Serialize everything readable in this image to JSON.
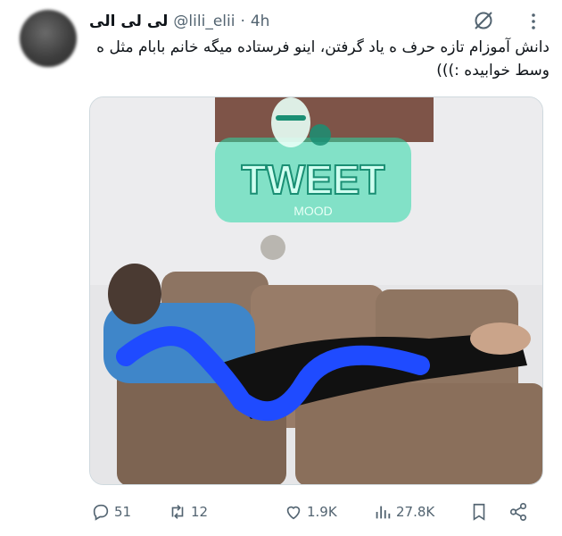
{
  "tweet": {
    "display_name": "لی لی الی",
    "handle": "@lili_elii",
    "separator": "·",
    "time": "4h",
    "text": "دانش آموزام تازه حرف ه یاد گرفتن، اینو فرستاده میگه خانم بابام مثل ه وسط خوابیده :)))"
  },
  "media": {
    "watermark_text": "TWEET",
    "watermark_subtext": "MOOD",
    "watermark_color": "#2bd9a8"
  },
  "actions": {
    "replies": "51",
    "retweets": "12",
    "likes": "1.9K",
    "views": "27.8K"
  },
  "icons": [
    "avatar",
    "grok-icon",
    "more-icon",
    "reply-icon",
    "retweet-icon",
    "like-icon",
    "views-icon",
    "bookmark-icon",
    "share-icon"
  ],
  "colors": {
    "text": "#0f1419",
    "secondary": "#536471",
    "border": "#cfd9de"
  }
}
